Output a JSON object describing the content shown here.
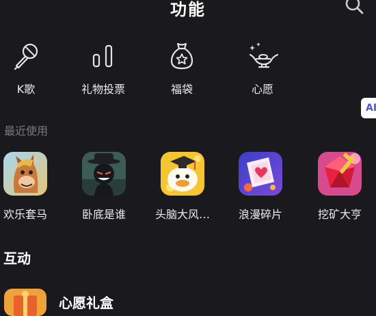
{
  "header": {
    "title": "功能"
  },
  "functions": [
    {
      "label": "K歌",
      "icon": "microphone-icon"
    },
    {
      "label": "礼物投票",
      "icon": "bar-chart-icon"
    },
    {
      "label": "福袋",
      "icon": "lucky-bag-icon"
    },
    {
      "label": "心愿",
      "icon": "magic-lamp-icon"
    }
  ],
  "ai_badge": {
    "text": "AI"
  },
  "recent": {
    "title": "最近使用",
    "apps": [
      {
        "label": "欢乐套马",
        "icon": "horse-game-icon"
      },
      {
        "label": "卧底是谁",
        "icon": "undercover-game-icon"
      },
      {
        "label": "头脑大风…",
        "icon": "brainstorm-game-icon"
      },
      {
        "label": "浪漫碎片",
        "icon": "romantic-fragments-icon"
      },
      {
        "label": "挖矿大亨",
        "icon": "mining-tycoon-icon"
      }
    ]
  },
  "interactive": {
    "title": "互动",
    "items": [
      {
        "label": "心愿礼盒",
        "icon": "wish-gift-box-icon"
      }
    ]
  },
  "colors": {
    "background": "#1a191d",
    "text_primary": "#ffffff",
    "text_secondary": "#7b7a80",
    "icon_stroke": "#e6e6e6"
  }
}
